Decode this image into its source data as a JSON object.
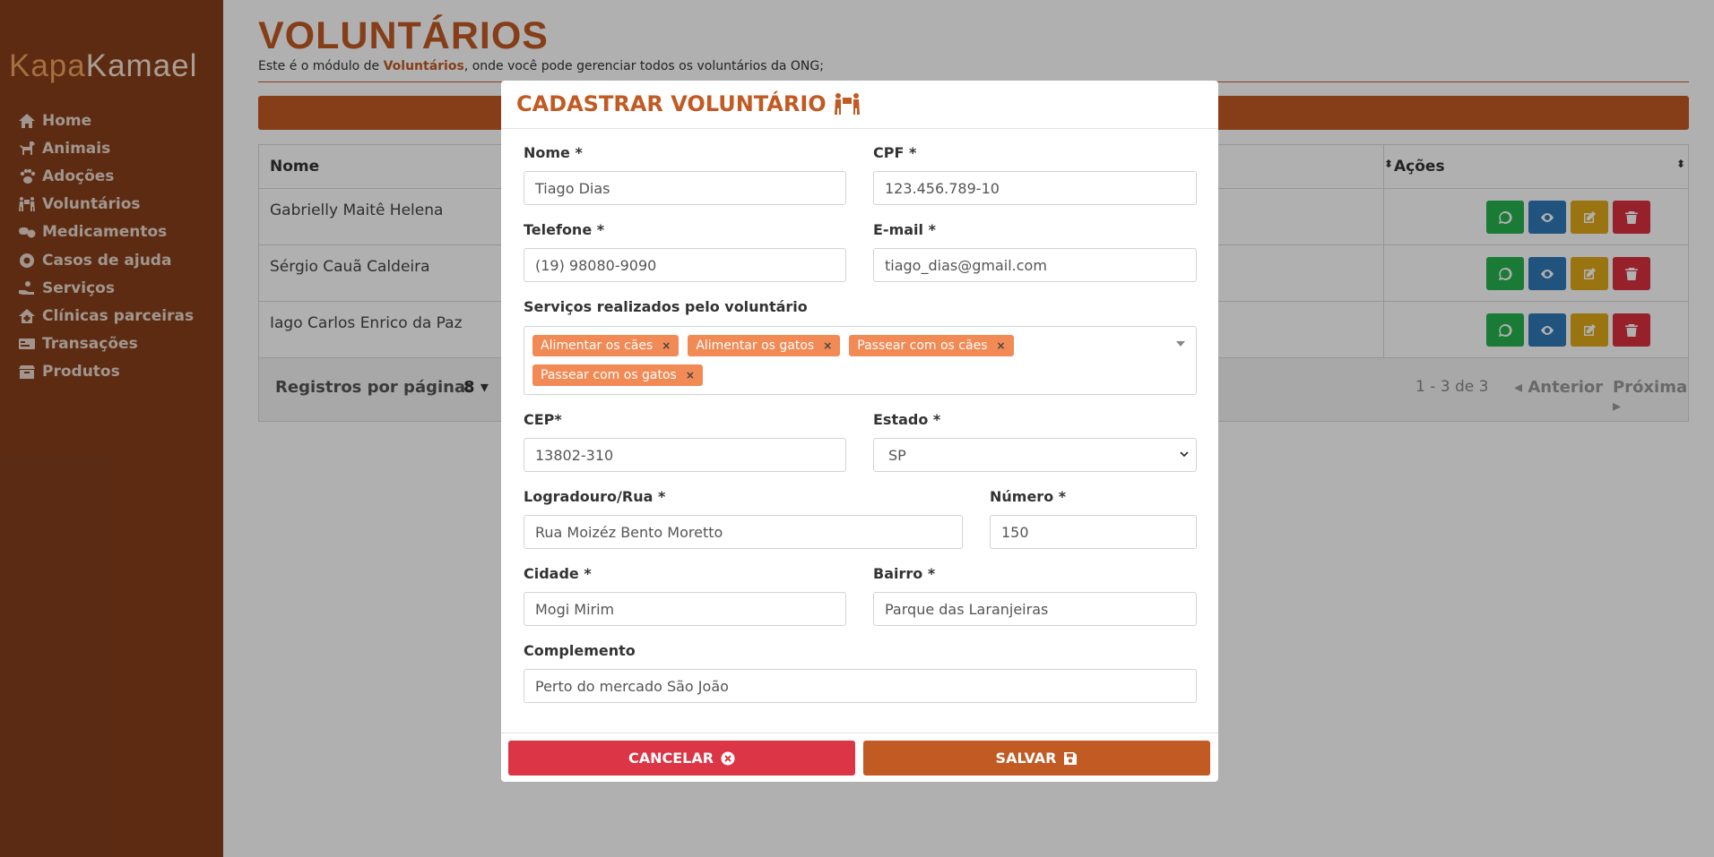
{
  "brand": {
    "part1": "Kapa",
    "part2": "Kamael"
  },
  "sidebar": {
    "items": [
      {
        "label": "Home",
        "icon": "home-icon"
      },
      {
        "label": "Animais",
        "icon": "dog-icon"
      },
      {
        "label": "Adoções",
        "icon": "paw-icon"
      },
      {
        "label": "Voluntários",
        "icon": "people-carry-icon"
      },
      {
        "label": "Medicamentos",
        "icon": "pills-icon"
      },
      {
        "label": "Casos de ajuda",
        "icon": "life-ring-icon"
      },
      {
        "label": "Serviços",
        "icon": "hand-holding-icon"
      },
      {
        "label": "Clínicas parceiras",
        "icon": "clinic-icon"
      },
      {
        "label": "Transações",
        "icon": "money-icon"
      },
      {
        "label": "Produtos",
        "icon": "box-icon"
      }
    ]
  },
  "page": {
    "title": "VOLUNTÁRIOS",
    "subtitle_pre": "Este é o módulo de ",
    "subtitle_bold": "Voluntários",
    "subtitle_post": ", onde você pode gerenciar todos os voluntários da ONG;"
  },
  "table": {
    "col_name": "Nome",
    "col_actions": "Ações",
    "rows": [
      {
        "name": "Gabrielly Maitê Helena"
      },
      {
        "name": "Sérgio Cauã Caldeira"
      },
      {
        "name": "Iago Carlos Enrico da Paz"
      }
    ],
    "footer": {
      "rows_per_page_label": "Registros por página:",
      "rows_per_page_value": "8",
      "range": "1 - 3 de 3",
      "prev": "Anterior",
      "next": "Próxima"
    }
  },
  "modal": {
    "title": "CADASTRAR VOLUNTÁRIO",
    "fields": {
      "nome": {
        "label": "Nome *",
        "value": "Tiago Dias"
      },
      "cpf": {
        "label": "CPF *",
        "value": "123.456.789-10"
      },
      "telefone": {
        "label": "Telefone *",
        "value": "(19) 98080-9090"
      },
      "email": {
        "label": "E-mail *",
        "value": "tiago_dias@gmail.com"
      },
      "servicos": {
        "label": "Serviços realizados pelo voluntário",
        "tags": [
          "Alimentar os cães",
          "Alimentar os gatos",
          "Passear com os cães",
          "Passear com os gatos"
        ]
      },
      "cep": {
        "label": "CEP*",
        "value": "13802-310"
      },
      "estado": {
        "label": "Estado *",
        "value": "SP"
      },
      "logradouro": {
        "label": "Logradouro/Rua *",
        "value": "Rua Moizéz Bento Moretto"
      },
      "numero": {
        "label": "Número *",
        "value": "150"
      },
      "cidade": {
        "label": "Cidade *",
        "value": "Mogi Mirim"
      },
      "bairro": {
        "label": "Bairro *",
        "value": "Parque das Laranjeiras"
      },
      "complemento": {
        "label": "Complemento",
        "value": "Perto do mercado São João"
      }
    },
    "buttons": {
      "cancel": "CANCELAR",
      "save": "SALVAR"
    }
  },
  "colors": {
    "sidebar": "#863f1b",
    "accent": "#c15a23",
    "tag": "#f28a55",
    "danger": "#dc3545",
    "whatsapp": "#27b34f",
    "view": "#2f7ab8",
    "edit": "#e0a81a",
    "delete": "#d9303e"
  }
}
